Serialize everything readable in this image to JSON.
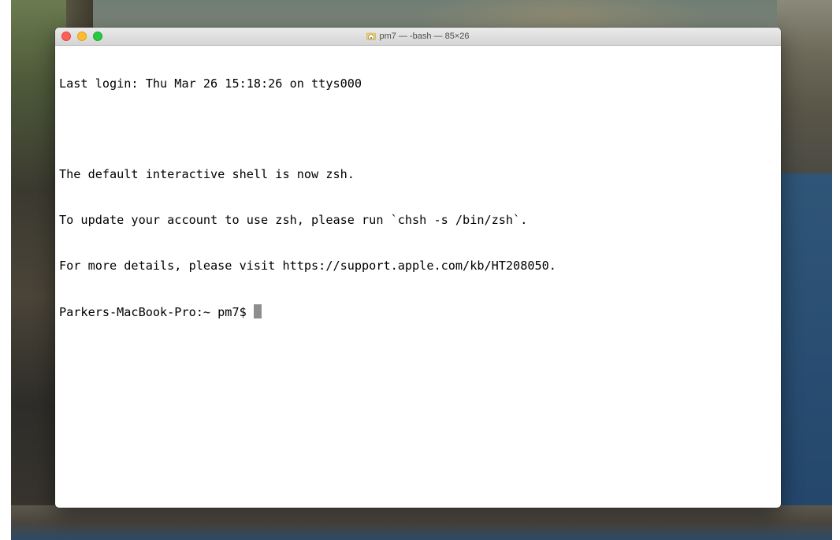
{
  "window": {
    "title": "pm7 — -bash — 85×26"
  },
  "terminal": {
    "lines": [
      "Last login: Thu Mar 26 15:18:26 on ttys000",
      "",
      "The default interactive shell is now zsh.",
      "To update your account to use zsh, please run `chsh -s /bin/zsh`.",
      "For more details, please visit https://support.apple.com/kb/HT208050."
    ],
    "prompt": "Parkers-MacBook-Pro:~ pm7$ "
  },
  "icons": {
    "close": "close-button",
    "minimize": "minimize-button",
    "zoom": "zoom-button",
    "title_icon": "home-folder-icon"
  },
  "colors": {
    "close": "#fe5f57",
    "minimize": "#febc2e",
    "zoom": "#28c840",
    "cursor": "#8e8e8e",
    "terminal_bg": "#ffffff",
    "terminal_fg": "#000000"
  }
}
